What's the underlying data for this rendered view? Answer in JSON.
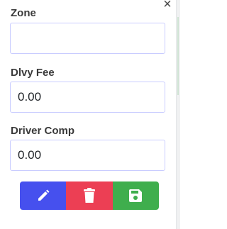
{
  "close": {
    "label": "×"
  },
  "fields": [
    {
      "label": "Zone",
      "value": ""
    },
    {
      "label": "Dlvy Fee",
      "value": "0.00"
    },
    {
      "label": "Driver Comp",
      "value": "0.00"
    }
  ],
  "actions": {
    "edit_icon": "pencil-icon",
    "delete_icon": "trash-icon",
    "save_icon": "floppy-disk-icon"
  },
  "colors": {
    "edit": "#4650ee",
    "delete": "#ec3f54",
    "save": "#3fae4d",
    "input_border": "#c9ccff"
  }
}
